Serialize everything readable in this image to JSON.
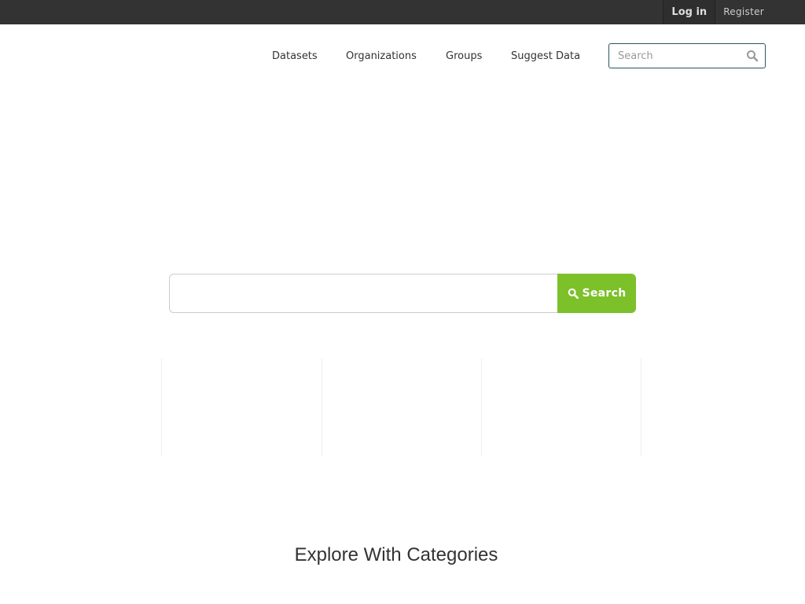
{
  "account": {
    "login_label": "Log in",
    "register_label": "Register"
  },
  "nav": {
    "items": [
      {
        "label": "Datasets"
      },
      {
        "label": "Organizations"
      },
      {
        "label": "Groups"
      },
      {
        "label": "Suggest Data"
      }
    ],
    "search_placeholder": "Search",
    "search_icon": "search-icon"
  },
  "hero": {
    "search_value": "",
    "search_button_label": "Search",
    "search_button_icon": "search-icon",
    "accent_color": "#7cc02a"
  },
  "categories": {
    "title": "Explore With Categories"
  },
  "colors": {
    "topbar": "#333333",
    "nav_search_border": "#2a5561",
    "text": "#333333"
  }
}
